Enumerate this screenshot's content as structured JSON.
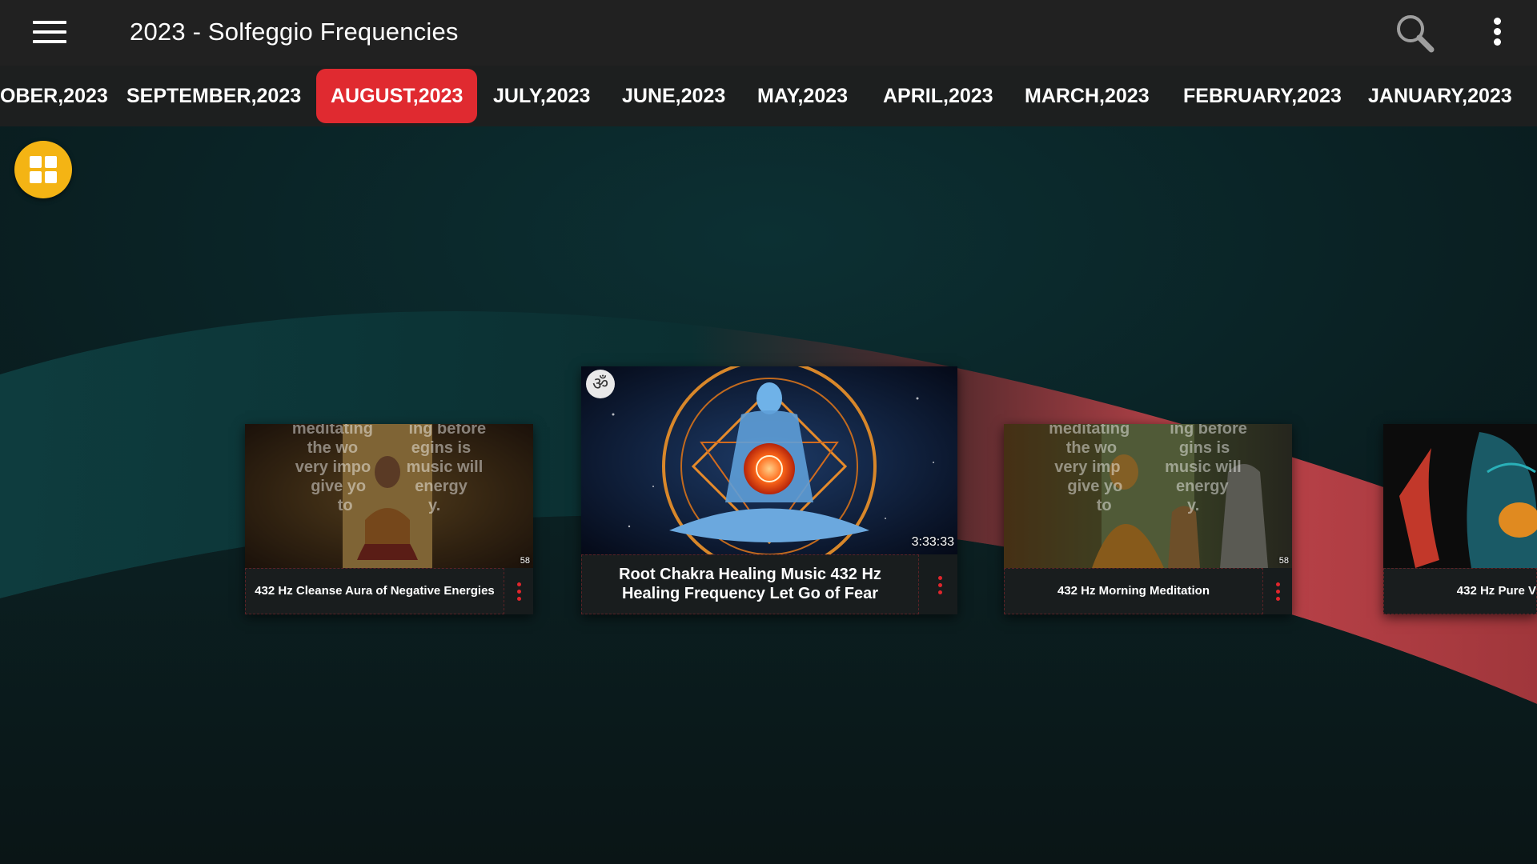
{
  "header": {
    "title": "2023 - Solfeggio Frequencies",
    "menu_icon": "hamburger-menu-icon",
    "search_icon": "search-icon",
    "overflow_icon": "more-vertical-icon"
  },
  "tabs": [
    {
      "label": "OBER,2023",
      "active": false
    },
    {
      "label": "SEPTEMBER,2023",
      "active": false
    },
    {
      "label": "AUGUST,2023",
      "active": true
    },
    {
      "label": "JULY,2023",
      "active": false
    },
    {
      "label": "JUNE,2023",
      "active": false
    },
    {
      "label": "MAY,2023",
      "active": false
    },
    {
      "label": "APRIL,2023",
      "active": false
    },
    {
      "label": "MARCH,2023",
      "active": false
    },
    {
      "label": "FEBRUARY,2023",
      "active": false
    },
    {
      "label": "JANUARY,2023",
      "active": false
    }
  ],
  "fab": {
    "icon": "grid-view-icon"
  },
  "videos": [
    {
      "title": "432 Hz Cleanse Aura of Negative Energies",
      "duration": "58",
      "overlay": "meditating        ing before\nthe wo            egins is\nvery impo        music will\ngive yo           energy\nto                 y."
    },
    {
      "title": "Root Chakra Healing Music  432 Hz Healing Frequency  Let Go of Fear",
      "duration": "3:33:33",
      "badge": "ॐ"
    },
    {
      "title": "432 Hz Morning Meditation",
      "duration": "58",
      "overlay": "meditating         ing before\nthe wo              gins is\nvery imp          music will\ngive yo            energy\nto                 y."
    },
    {
      "title": "432 Hz Pure V",
      "duration": ""
    }
  ],
  "colors": {
    "accent": "#e02a30",
    "fab": "#f4b414",
    "topbar": "#212121",
    "background": "#0b1416"
  }
}
